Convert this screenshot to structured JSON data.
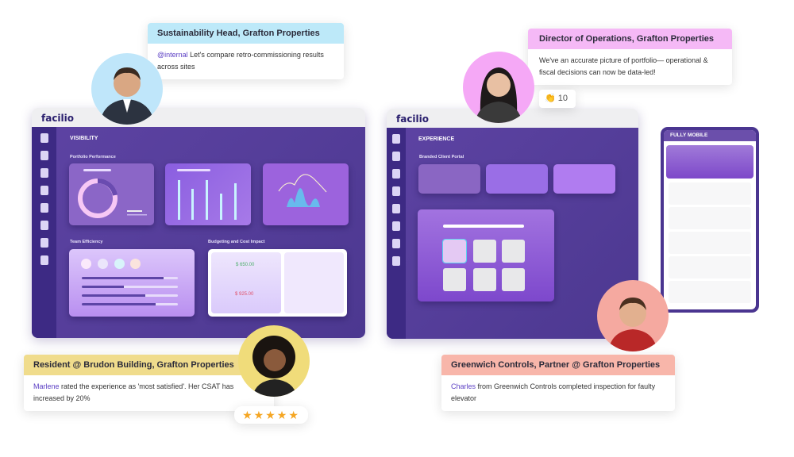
{
  "left_dashboard": {
    "brand": "facilio",
    "section": "VISIBILITY",
    "portfolio_label": "Portfolio Performance",
    "team_label": "Team Efficiency",
    "budget_label": "Budgeting and Cost Impact",
    "amount_green": "$ 650.00",
    "amount_red": "$ 925.00"
  },
  "right_dashboard": {
    "brand": "facilio",
    "section": "EXPERIENCE",
    "portal_label": "Branded Client Portal"
  },
  "mobile": {
    "title": "FULLY MOBILE"
  },
  "quotes": [
    {
      "header": "Sustainability Head, Grafton Properties",
      "mention": "@internal",
      "text": " Let's compare retro-commissioning results across sites",
      "color": "#bde9f9"
    },
    {
      "header": "Director of Operations, Grafton Properties",
      "mention": "",
      "text": "We've an accurate picture of portfolio— operational & fiscal decisions can now be data-led!",
      "color": "#f5b9f6"
    },
    {
      "header": "Resident @ Brudon Building, Grafton Properties",
      "mention": "Marlene",
      "text": " rated the experience as 'most satisfied'. Her CSAT has increased by 20%",
      "color": "#f0dc8c"
    },
    {
      "header": "Greenwich Controls, Partner @ Grafton Properties",
      "mention": "Charles",
      "text": " from Greenwich Controls completed inspection for faulty elevator",
      "color": "#f8b6aa"
    }
  ],
  "reaction": {
    "icon": "clap-icon",
    "emoji": "👏",
    "count": "10"
  },
  "rating": {
    "stars": 5,
    "max": 5,
    "glyph": "★"
  }
}
